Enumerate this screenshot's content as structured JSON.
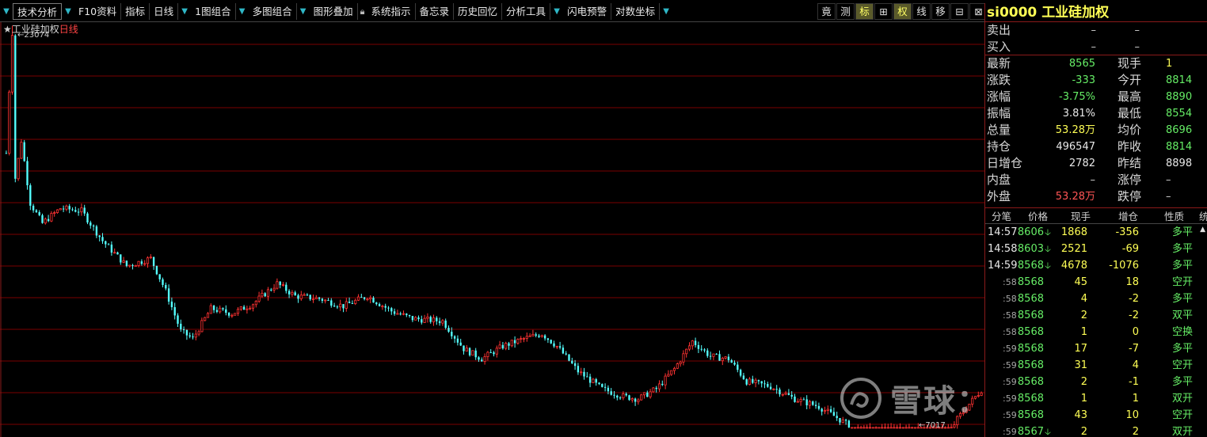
{
  "toolbar": {
    "left": [
      {
        "label": "技术分析",
        "arrow": true,
        "boxed": true
      },
      {
        "label": "F10资料"
      },
      {
        "label": "指标"
      },
      {
        "label": "日线",
        "arrow": true
      },
      {
        "label": "1图组合",
        "arrow": true
      },
      {
        "label": "多图组合",
        "arrow": true
      },
      {
        "label": "图形叠加",
        "lock": true
      },
      {
        "label": "系统指示"
      },
      {
        "label": "备忘录"
      },
      {
        "label": "历史回忆"
      },
      {
        "label": "分析工具",
        "arrow": true
      },
      {
        "label": "闪电预警"
      },
      {
        "label": "对数坐标",
        "arrow": true
      }
    ],
    "right": [
      {
        "label": "竟"
      },
      {
        "label": "测"
      },
      {
        "label": "标",
        "active": true
      },
      {
        "label": "⊞"
      },
      {
        "label": "权",
        "active": true
      },
      {
        "label": "线"
      },
      {
        "label": "移"
      },
      {
        "label": "⊟"
      },
      {
        "label": "⊠"
      }
    ]
  },
  "chart": {
    "star": "★",
    "name": "工业硅加权",
    "period": "日线",
    "high_label": "←23074",
    "low_label": "←7017",
    "high_value": 23074,
    "low_value": 7017,
    "up_color": "#ff3232",
    "down_color": "#54ffff",
    "grid_color": "#7a0000"
  },
  "chart_data": {
    "type": "candlestick",
    "instrument": "工业硅加权",
    "period": "日线",
    "high": 23074,
    "low": 7017,
    "close_last": 8565,
    "trend_path": [
      [
        0,
        18000
      ],
      [
        1,
        20500
      ],
      [
        2,
        22800
      ],
      [
        3,
        17000
      ],
      [
        5,
        18500
      ],
      [
        8,
        16000
      ],
      [
        12,
        15200
      ],
      [
        18,
        15800
      ],
      [
        25,
        15700
      ],
      [
        32,
        14500
      ],
      [
        40,
        13500
      ],
      [
        48,
        13800
      ],
      [
        53,
        12500
      ],
      [
        58,
        10900
      ],
      [
        62,
        10600
      ],
      [
        68,
        11800
      ],
      [
        75,
        11600
      ],
      [
        82,
        12000
      ],
      [
        90,
        12800
      ],
      [
        96,
        12300
      ],
      [
        104,
        12200
      ],
      [
        112,
        11900
      ],
      [
        120,
        12300
      ],
      [
        128,
        11700
      ],
      [
        135,
        11400
      ],
      [
        145,
        11300
      ],
      [
        152,
        10200
      ],
      [
        158,
        9800
      ],
      [
        165,
        10300
      ],
      [
        172,
        10600
      ],
      [
        178,
        10800
      ],
      [
        183,
        10300
      ],
      [
        190,
        9300
      ],
      [
        198,
        8600
      ],
      [
        205,
        8300
      ],
      [
        210,
        8200
      ],
      [
        216,
        8600
      ],
      [
        222,
        9400
      ],
      [
        228,
        10500
      ],
      [
        234,
        9900
      ],
      [
        240,
        9800
      ],
      [
        246,
        8900
      ],
      [
        254,
        8700
      ],
      [
        262,
        8200
      ],
      [
        270,
        7900
      ],
      [
        278,
        7300
      ],
      [
        285,
        6700
      ],
      [
        292,
        5800
      ],
      [
        298,
        4950
      ],
      [
        304,
        5300
      ],
      [
        310,
        6200
      ],
      [
        316,
        7400
      ],
      [
        320,
        8000
      ],
      [
        324,
        8565
      ]
    ]
  },
  "panel": {
    "code": "si0000",
    "name": "工业硅加权",
    "sell": {
      "label": "卖出",
      "v1": "–",
      "v2": "–"
    },
    "buy": {
      "label": "买入",
      "v1": "–",
      "v2": "–"
    },
    "rows": [
      {
        "l": "最新",
        "v": "8565",
        "vc": "c-green",
        "l2": "现手",
        "v2": "1",
        "v2c": "c-yellow"
      },
      {
        "l": "涨跌",
        "v": "-333",
        "vc": "c-green",
        "l2": "今开",
        "v2": "8814",
        "v2c": "c-green"
      },
      {
        "l": "涨幅",
        "v": "-3.75%",
        "vc": "c-green",
        "l2": "最高",
        "v2": "8890",
        "v2c": "c-green"
      },
      {
        "l": "振幅",
        "v": "3.81%",
        "vc": "c-white",
        "l2": "最低",
        "v2": "8554",
        "v2c": "c-green"
      },
      {
        "l": "总量",
        "v": "53.28万",
        "vc": "c-yellow",
        "l2": "均价",
        "v2": "8696",
        "v2c": "c-green"
      },
      {
        "l": "持仓",
        "v": "496547",
        "vc": "c-white",
        "l2": "昨收",
        "v2": "8814",
        "v2c": "c-green"
      },
      {
        "l": "日增仓",
        "v": "2782",
        "vc": "c-white",
        "l2": "昨结",
        "v2": "8898",
        "v2c": "c-white"
      },
      {
        "l": "内盘",
        "v": "–",
        "vc": "c-dash",
        "l2": "涨停",
        "v2": "–",
        "v2c": "c-dash"
      },
      {
        "l": "外盘",
        "v": "53.28万",
        "vc": "c-red",
        "l2": "跌停",
        "v2": "–",
        "v2c": "c-dash"
      }
    ],
    "ticks_header": [
      "分笔",
      "价格",
      "现手",
      "增仓",
      "性质",
      "统"
    ],
    "ticks": [
      {
        "t": "14:57",
        "p": "8606",
        "a": "🡣",
        "v": "1868",
        "c": "-356",
        "k": "多平",
        "small": false
      },
      {
        "t": "14:58",
        "p": "8603",
        "a": "🡣",
        "v": "2521",
        "c": "-69",
        "k": "多平",
        "small": false
      },
      {
        "t": "14:59",
        "p": "8568",
        "a": "🡣",
        "v": "4678",
        "c": "-1076",
        "k": "多平",
        "small": false
      },
      {
        "t": ":58",
        "p": "8568",
        "a": "",
        "v": "45",
        "c": "18",
        "k": "空开",
        "small": true
      },
      {
        "t": ":58",
        "p": "8568",
        "a": "",
        "v": "4",
        "c": "-2",
        "k": "多平",
        "small": true
      },
      {
        "t": ":58",
        "p": "8568",
        "a": "",
        "v": "2",
        "c": "-2",
        "k": "双平",
        "small": true
      },
      {
        "t": ":58",
        "p": "8568",
        "a": "",
        "v": "1",
        "c": "0",
        "k": "空换",
        "small": true
      },
      {
        "t": ":59",
        "p": "8568",
        "a": "",
        "v": "17",
        "c": "-7",
        "k": "多平",
        "small": true
      },
      {
        "t": ":59",
        "p": "8568",
        "a": "",
        "v": "31",
        "c": "4",
        "k": "空开",
        "small": true
      },
      {
        "t": ":59",
        "p": "8568",
        "a": "",
        "v": "2",
        "c": "-1",
        "k": "多平",
        "small": true
      },
      {
        "t": ":59",
        "p": "8568",
        "a": "",
        "v": "1",
        "c": "1",
        "k": "双开",
        "small": true
      },
      {
        "t": ":59",
        "p": "8568",
        "a": "",
        "v": "43",
        "c": "10",
        "k": "空开",
        "small": true
      },
      {
        "t": ":59",
        "p": "8567",
        "a": "🡣",
        "v": "2",
        "c": "2",
        "k": "双开",
        "small": true
      }
    ]
  },
  "watermark": {
    "text": "雪球：戴维斯双击"
  }
}
